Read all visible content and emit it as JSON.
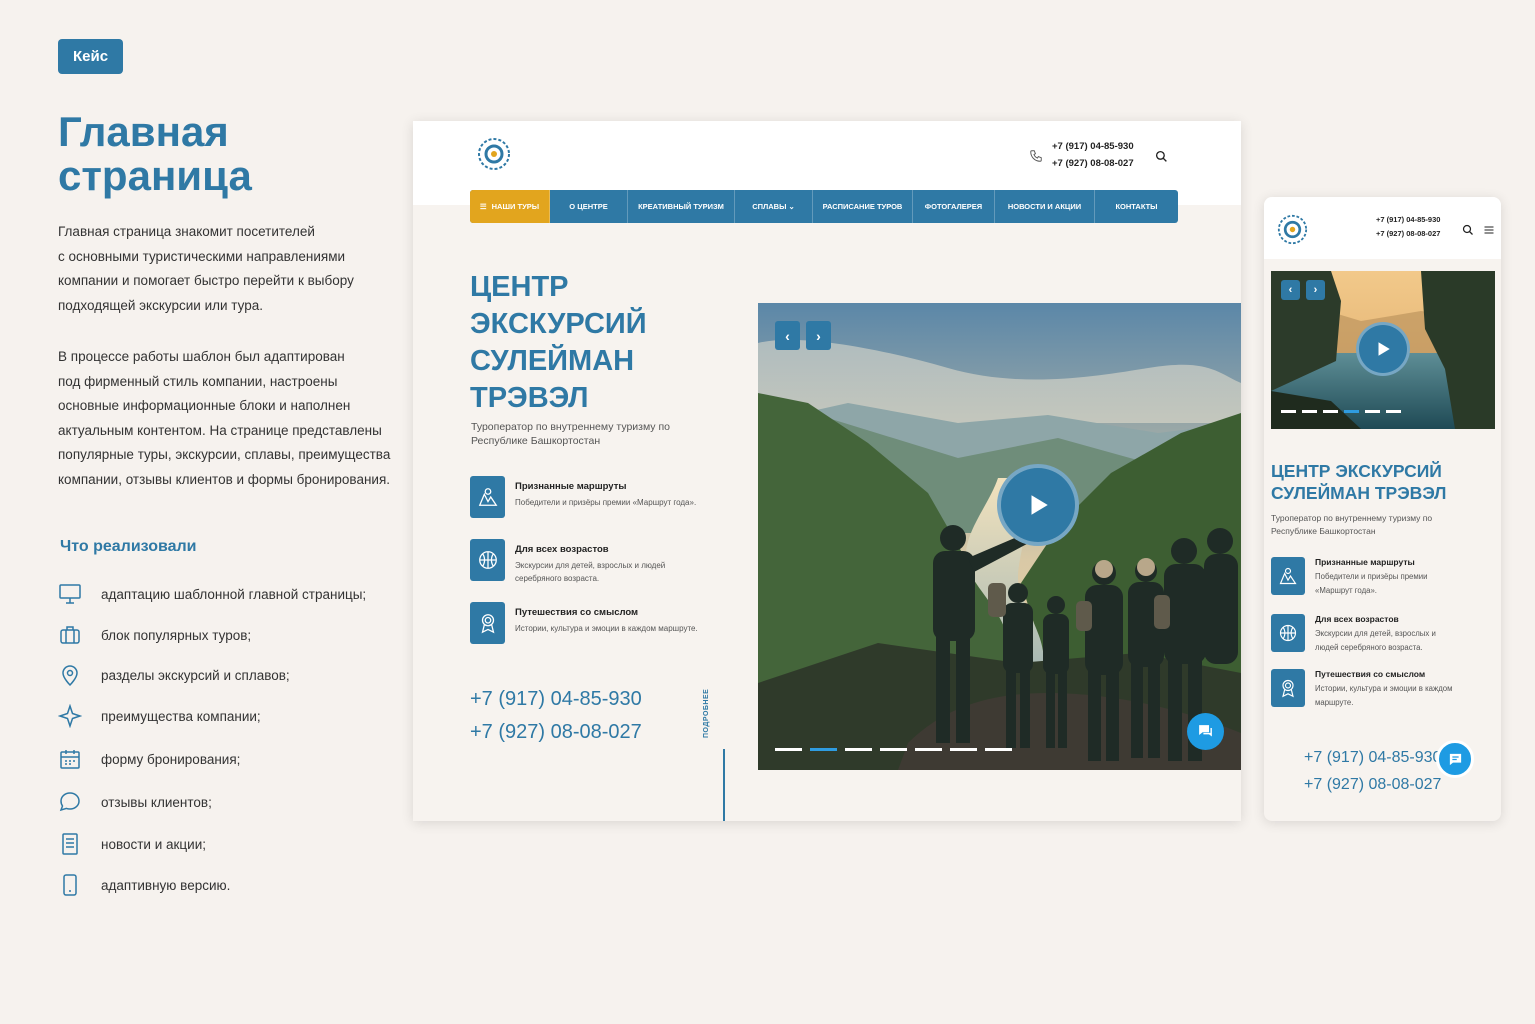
{
  "badge": "Кейс",
  "page_title": "Главная\nстраница",
  "intro_1": "Главная страница знакомит посетителей\nс основными туристическими направлениями\nкомпании и помогает быстро перейти к выбору\nподходящей экскурсии или тура.",
  "intro_2": "В процессе работы шаблон был адаптирован\nпод фирменный стиль компании, настроены\nосновные информационные блоки и наполнен\nактуальным контентом. На странице представлены\nпопулярные туры, экскурсии, сплавы, преимущества\nкомпании, отзывы клиентов и формы бронирования.",
  "section_title": "Что реализовали",
  "features": [
    {
      "icon": "monitor-icon",
      "label": "адаптацию шаблонной главной страницы;"
    },
    {
      "icon": "suitcase-icon",
      "label": "блок популярных туров;"
    },
    {
      "icon": "location-pin-icon",
      "label": "разделы экскурсий и сплавов;"
    },
    {
      "icon": "sparkle-icon",
      "label": "преимущества компании;"
    },
    {
      "icon": "calendar-icon",
      "label": "форму бронирования;"
    },
    {
      "icon": "chat-bubble-icon",
      "label": "отзывы клиентов;"
    },
    {
      "icon": "document-icon",
      "label": "новости и акции;"
    },
    {
      "icon": "smartphone-icon",
      "label": "адаптивную версию."
    }
  ],
  "desktop": {
    "phone_1": "+7 (917) 04-85-930",
    "phone_2": "+7 (927) 08-08-027",
    "nav": [
      "НАШИ ТУРЫ",
      "О ЦЕНТРЕ",
      "КРЕАТИВНЫЙ ТУРИЗМ",
      "СПЛАВЫ ⌄",
      "РАСПИСАНИЕ ТУРОВ",
      "ФОТОГАЛЕРЕЯ",
      "НОВОСТИ И АКЦИИ",
      "КОНТАКТЫ"
    ],
    "hero_title": "ЦЕНТР\nЭКСКУРСИЙ\nСУЛЕЙМАН\nТРЭВЭЛ",
    "hero_subtitle": "Туроператор по внутреннему туризму по\nРеспублике Башкортостан",
    "items": [
      {
        "title": "Признанные маршруты",
        "text": "Победители и призёры премии «Маршрут года»."
      },
      {
        "title": "Для всех возрастов",
        "text": "Экскурсии для детей, взрослых и людей\nсеребряного возраста."
      },
      {
        "title": "Путешествия со смыслом",
        "text": "Истории, культура и эмоции в каждом маршруте."
      }
    ],
    "big_phone_1": "+7 (917) 04-85-930",
    "big_phone_2": "+7 (927) 08-08-027",
    "more_label": "ПОДРОБНЕЕ",
    "slides": 7,
    "active_slide": 2
  },
  "mobile": {
    "phone_1": "+7 (917) 04-85-930",
    "phone_2": "+7 (927) 08-08-027",
    "hero_title": "ЦЕНТР ЭКСКУРСИЙ\nСУЛЕЙМАН ТРЭВЭЛ",
    "hero_subtitle": "Туроператор по внутреннему туризму по\nРеспублике Башкортостан",
    "items": [
      {
        "title": "Признанные маршруты",
        "text": "Победители и призёры премии\n«Маршрут года»."
      },
      {
        "title": "Для всех возрастов",
        "text": "Экскурсии для детей, взрослых и\nлюдей серебряного возраста."
      },
      {
        "title": "Путешествия со смыслом",
        "text": "Истории, культура и эмоции в каждом\nмаршруте."
      }
    ],
    "big_phone_1": "+7 (917) 04-85-930",
    "big_phone_2": "+7 (927) 08-08-027",
    "slides": 6,
    "active_slide": 4
  },
  "colors": {
    "accent": "#2f79a5",
    "nav_active": "#e2a51e",
    "chat": "#1e9be3",
    "background": "#f6f2ee"
  }
}
